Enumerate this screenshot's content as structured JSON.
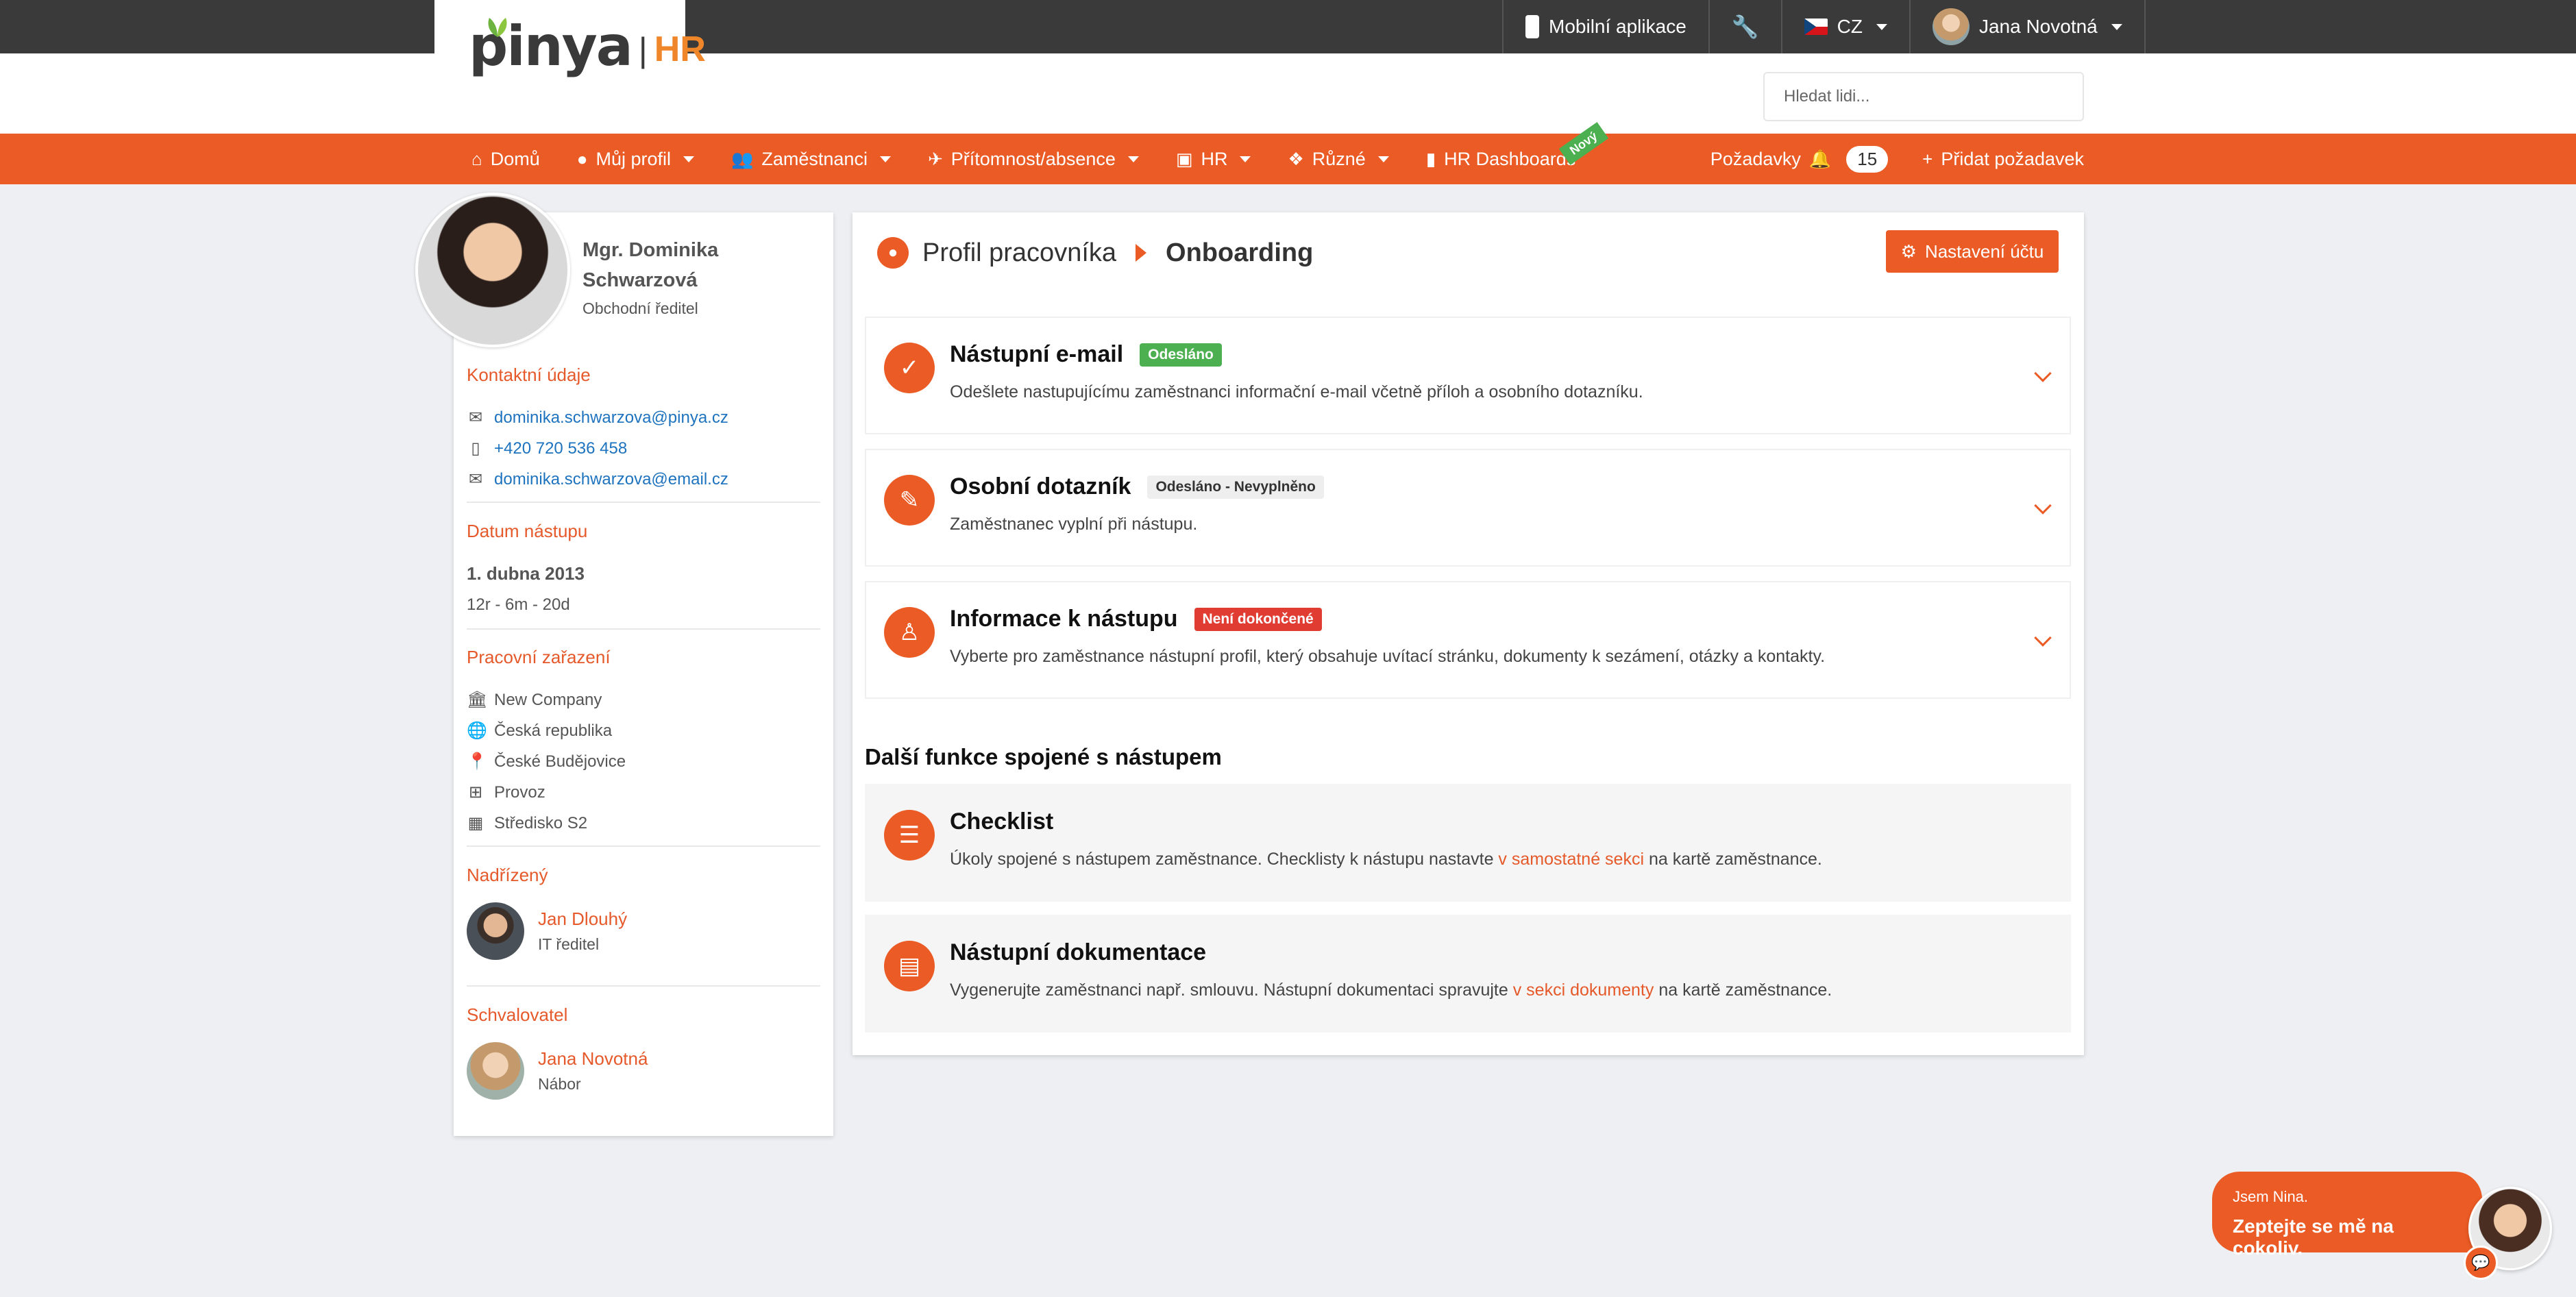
{
  "topbar": {
    "mobile_app": "Mobilní aplikace",
    "language": "CZ",
    "user_name": "Jana Novotná"
  },
  "header": {
    "logo_text": "pinya",
    "logo_sep": "|",
    "logo_hr": "HR",
    "search_placeholder": "Hledat lidi..."
  },
  "nav": {
    "items": [
      {
        "label": "Domů",
        "icon": "home-icon"
      },
      {
        "label": "Můj profil",
        "icon": "user-circle-icon"
      },
      {
        "label": "Zaměstnanci",
        "icon": "users-icon"
      },
      {
        "label": "Přítomnost/absence",
        "icon": "plane-icon"
      },
      {
        "label": "HR",
        "icon": "id-card-icon"
      },
      {
        "label": "Různé",
        "icon": "cubes-icon"
      },
      {
        "label": "HR Dashboards",
        "icon": "chart-icon"
      }
    ],
    "new_badge": "Nový",
    "requests_label": "Požadavky",
    "requests_count": "15",
    "add_request": "Přidat požadavek"
  },
  "profile": {
    "name": "Mgr. Dominika Schwarzová",
    "role": "Obchodní ředitel",
    "contact_title": "Kontaktní údaje",
    "email_work": "dominika.schwarzova@pinya.cz",
    "phone": "+420 720 536 458",
    "email_private": "dominika.schwarzova@email.cz",
    "start_title": "Datum nástupu",
    "start_date": "1. dubna 2013",
    "tenure": "12r - 6m - 20d",
    "position_title": "Pracovní zařazení",
    "company": "New Company",
    "country": "Česká republika",
    "city": "České Budějovice",
    "department": "Provoz",
    "cost_center": "Středisko S2",
    "manager_title": "Nadřízený",
    "manager_name": "Jan Dlouhý",
    "manager_role": "IT ředitel",
    "approver_title": "Schvalovatel",
    "approver_name": "Jana Novotná",
    "approver_role": "Nábor"
  },
  "main": {
    "crumb_parent": "Profil pracovníka",
    "crumb_current": "Onboarding",
    "settings_button": "Nastavení účtu",
    "items": [
      {
        "title": "Nástupní e-mail",
        "status": "Odesláno",
        "desc": "Odešlete nastupujícímu zaměstnanci informační e-mail včetně příloh a osobního dotazníku."
      },
      {
        "title": "Osobní dotazník",
        "status": "Odesláno - Nevyplněno",
        "desc": "Zaměstnanec vyplní při nástupu."
      },
      {
        "title": "Informace k nástupu",
        "status": "Není dokončené",
        "desc": "Vyberte pro zaměstnance nástupní profil, který obsahuje uvítací stránku, dokumenty k sezámení, otázky a kontakty."
      }
    ],
    "more_title": "Další funkce spojené s nástupem",
    "checklist": {
      "title": "Checklist",
      "desc_before": "Úkoly spojené s nástupem zaměstnance. Checklisty k nástupu nastavte ",
      "link": "v samostatné sekci",
      "desc_after": " na kartě zaměstnance."
    },
    "docs": {
      "title": "Nástupní dokumentace",
      "desc_before": "Vygenerujte zaměstnanci např. smlouvu. Nástupní dokumentaci spravujte ",
      "link": "v sekci dokumenty",
      "desc_after": " na kartě zaměstnance."
    }
  },
  "chat": {
    "small": "Jsem Nina.",
    "big": "Zeptejte se mě na cokoliv."
  },
  "colors": {
    "accent": "#eb5b25",
    "topbar": "#3a3a3a",
    "success": "#4caf50",
    "danger": "#e03c31"
  }
}
